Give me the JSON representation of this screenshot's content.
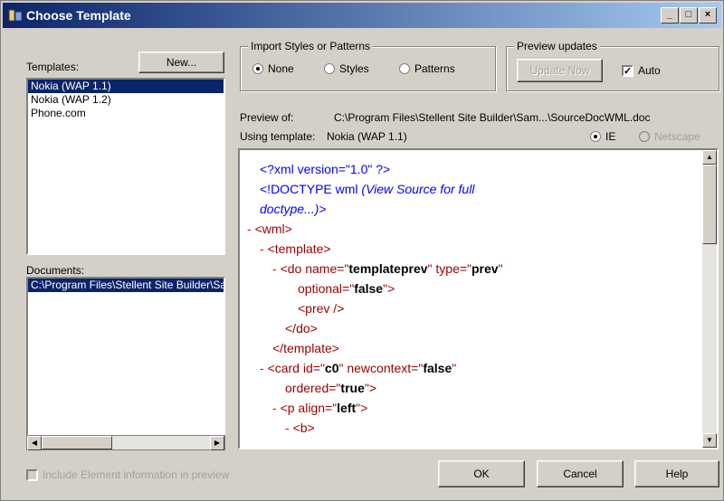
{
  "window": {
    "title": "Choose Template",
    "controls": [
      "_",
      "□",
      "×"
    ]
  },
  "templates": {
    "label": "Templates:",
    "items": [
      "Nokia (WAP 1.1)",
      "Nokia (WAP 1.2)",
      "Phone.com"
    ],
    "selected_index": 0
  },
  "new_button": "New...",
  "documents": {
    "label": "Documents:",
    "items": [
      "C:\\Program Files\\Stellent Site Builder\\Sam..."
    ],
    "selected_index": 0
  },
  "import_group": {
    "label": "Import Styles or Patterns",
    "options": [
      "None",
      "Styles",
      "Patterns"
    ],
    "selected": "None"
  },
  "preview_group": {
    "label": "Preview updates",
    "update_now": "Update Now",
    "auto_label": "Auto",
    "auto_checked": true
  },
  "preview_of": {
    "label": "Preview of:",
    "value": "C:\\Program Files\\Stellent Site Builder\\Sam...\\SourceDocWML.doc"
  },
  "using_template": {
    "label": "Using template:",
    "value": "Nokia (WAP 1.1)"
  },
  "browser": {
    "options": [
      "IE",
      "Netscape"
    ],
    "selected": "IE"
  },
  "code_lines": [
    {
      "minus": "",
      "indent": 1,
      "parts": [
        [
          "pi",
          "<?xml version=\"1.0\" ?>"
        ]
      ]
    },
    {
      "minus": "",
      "indent": 1,
      "parts": [
        [
          "pi",
          "<!DOCTYPE wml "
        ],
        [
          "cm",
          "(View Source for full"
        ]
      ]
    },
    {
      "minus": "",
      "indent": 1,
      "parts": [
        [
          "cm",
          "doctype...)"
        ],
        [
          "pi",
          ">"
        ]
      ]
    },
    {
      "minus": "-",
      "indent": 0,
      "parts": [
        [
          "tag",
          "<wml>"
        ]
      ]
    },
    {
      "minus": "-",
      "indent": 1,
      "parts": [
        [
          "tag",
          "<template>"
        ]
      ]
    },
    {
      "minus": "-",
      "indent": 2,
      "parts": [
        [
          "tag",
          "<do "
        ],
        [
          "attr",
          "name=\""
        ],
        [
          "val",
          "templateprev"
        ],
        [
          "attr",
          "\" type=\""
        ],
        [
          "val",
          "prev"
        ],
        [
          "attr",
          "\""
        ]
      ]
    },
    {
      "minus": "",
      "indent": 4,
      "parts": [
        [
          "attr",
          "optional=\""
        ],
        [
          "val",
          "false"
        ],
        [
          "attr",
          "\">"
        ]
      ]
    },
    {
      "minus": "",
      "indent": 4,
      "parts": [
        [
          "tag",
          "<prev />"
        ]
      ]
    },
    {
      "minus": "",
      "indent": 3,
      "parts": [
        [
          "tag",
          "</do>"
        ]
      ]
    },
    {
      "minus": "",
      "indent": 2,
      "parts": [
        [
          "tag",
          "</template>"
        ]
      ]
    },
    {
      "minus": "-",
      "indent": 1,
      "parts": [
        [
          "tag",
          "<card "
        ],
        [
          "attr",
          "id=\""
        ],
        [
          "val",
          "c0"
        ],
        [
          "attr",
          "\" newcontext=\""
        ],
        [
          "val",
          "false"
        ],
        [
          "attr",
          "\""
        ]
      ]
    },
    {
      "minus": "",
      "indent": 3,
      "parts": [
        [
          "attr",
          "ordered=\""
        ],
        [
          "val",
          "true"
        ],
        [
          "attr",
          "\">"
        ]
      ]
    },
    {
      "minus": "-",
      "indent": 2,
      "parts": [
        [
          "tag",
          "<p "
        ],
        [
          "attr",
          "align=\""
        ],
        [
          "val",
          "left"
        ],
        [
          "attr",
          "\">"
        ]
      ]
    },
    {
      "minus": "-",
      "indent": 3,
      "parts": [
        [
          "tag",
          "<b>"
        ]
      ]
    }
  ],
  "include_element_info": {
    "label": "Include Element information in preview",
    "checked": false,
    "enabled": false
  },
  "buttons": {
    "ok": "OK",
    "cancel": "Cancel",
    "help": "Help"
  },
  "colors": {
    "title_start": "#0a246a",
    "title_end": "#a6caf0",
    "face": "#d4d0c8",
    "selection": "#0a246a"
  }
}
